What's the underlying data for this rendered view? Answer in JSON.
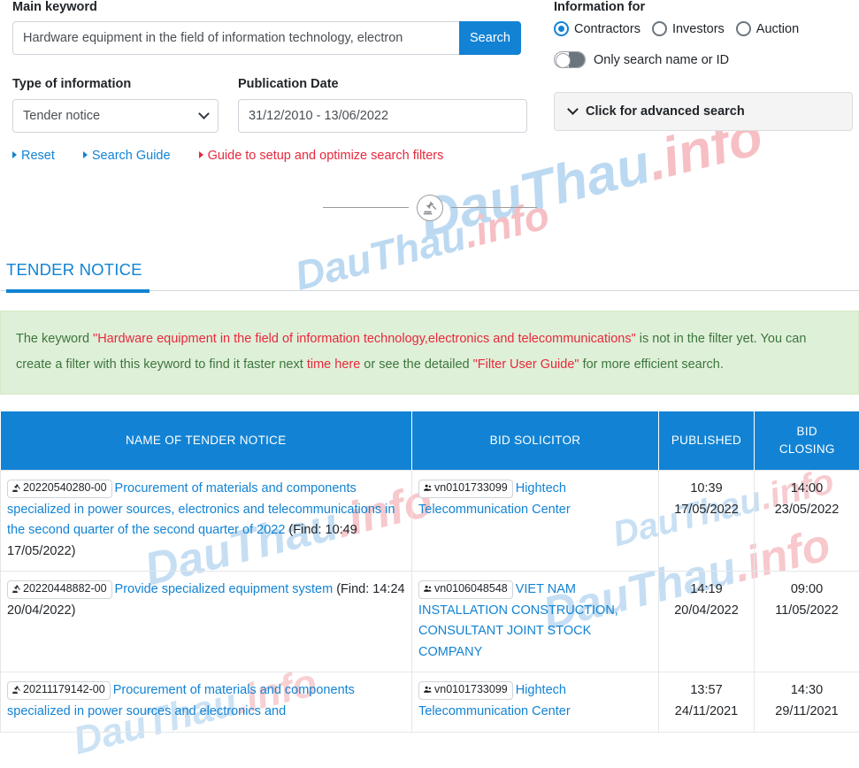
{
  "search": {
    "main_keyword_label": "Main keyword",
    "keyword_value": "Hardware equipment in the field of information technology, electron",
    "keyword_placeholder": "Main keyword",
    "search_button": "Search",
    "type_label": "Type of information",
    "type_value": "Tender notice",
    "date_label": "Publication Date",
    "date_value": "31/12/2010 - 13/06/2022",
    "links": [
      {
        "label": "Reset",
        "color": "#1283d4"
      },
      {
        "label": "Search Guide",
        "color": "#1283d4"
      },
      {
        "label": "Guide to setup and optimize search filters",
        "color": "#e8283c"
      }
    ]
  },
  "info_for": {
    "label": "Information for",
    "options": [
      {
        "label": "Contractors",
        "selected": true
      },
      {
        "label": "Investors",
        "selected": false
      },
      {
        "label": "Auction",
        "selected": false
      }
    ],
    "toggle_label": "Only search name or ID",
    "toggle_on": false,
    "advanced_label": "Click for advanced search"
  },
  "tab": {
    "label": "TENDER NOTICE"
  },
  "alert": {
    "t1": "The keyword ",
    "keyword": "\"Hardware equipment in the field of information technology,electronics and telecommunications\"",
    "t2": " is not in the filter yet. You can create a filter with this keyword to find it faster next ",
    "link_time": "time",
    "t3": " ",
    "link_here": "here",
    "t4": " or see the detailed ",
    "link_guide": "\"Filter User Guide\"",
    "t5": " for more efficient search."
  },
  "table": {
    "headers": [
      "NAME OF TENDER NOTICE",
      "BID SOLICITOR",
      "PUBLISHED",
      "BID CLOSING"
    ],
    "header_bid_closing_line1": "BID",
    "header_bid_closing_line2": "CLOSING",
    "rows": [
      {
        "code": "20220540280-00",
        "name": "Procurement of materials and components specialized in power sources, electronics and telecommunications in the second quarter of the second quarter of 2022",
        "find": " (Find: 10:49 17/05/2022)",
        "solicitor_code": "vn0101733099",
        "solicitor_name": "Hightech Telecommunication Center",
        "published_time": "10:39",
        "published_date": "17/05/2022",
        "closing_time": "14:00",
        "closing_date": "23/05/2022"
      },
      {
        "code": "20220448882-00",
        "name": "Provide specialized equipment system",
        "find": " (Find: 14:24 20/04/2022)",
        "solicitor_code": "vn0106048548",
        "solicitor_name": "VIET NAM INSTALLATION CONSTRUCTION, CONSULTANT JOINT STOCK COMPANY",
        "published_time": "14:19",
        "published_date": "20/04/2022",
        "closing_time": "09:00",
        "closing_date": "11/05/2022"
      },
      {
        "code": "20211179142-00",
        "name": "Procurement of materials and components specialized in power sources and electronics and",
        "find": "",
        "solicitor_code": "vn0101733099",
        "solicitor_name": "Hightech Telecommunication Center",
        "published_time": "13:57",
        "published_date": "24/11/2021",
        "closing_time": "14:30",
        "closing_date": "29/11/2021"
      }
    ]
  },
  "watermark": {
    "blue": "DauThau",
    "red": ".info"
  },
  "colors": {
    "primary": "#1283d4",
    "link_red": "#e8283c",
    "alert_bg": "#dff0d8",
    "alert_text": "#3c763d"
  }
}
